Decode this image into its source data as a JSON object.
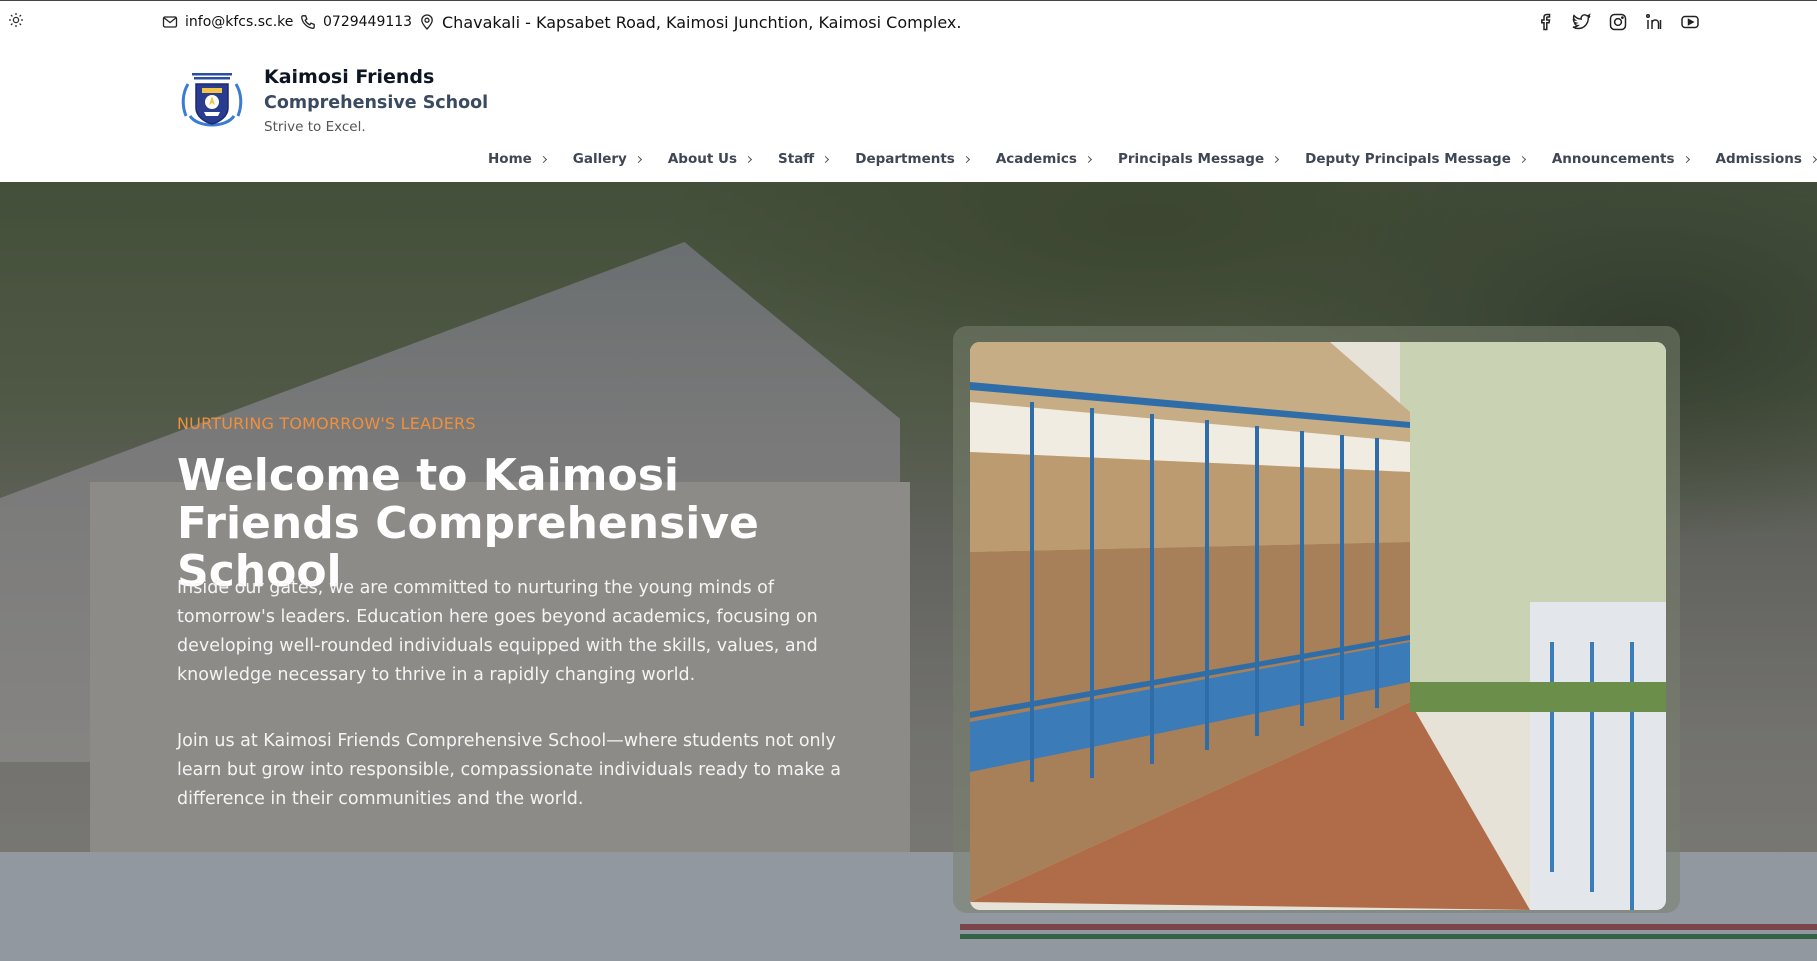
{
  "topbar": {
    "email": "info@kfcs.sc.ke",
    "phone": "0729449113",
    "address": "Chavakali - Kapsabet Road, Kaimosi Junchtion, Kaimosi Complex.",
    "socials": [
      "facebook-icon",
      "twitter-icon",
      "instagram-icon",
      "linkedin-icon",
      "youtube-icon"
    ]
  },
  "header": {
    "brand_name": "Kaimosi Friends",
    "brand_sub": "Comprehensive School",
    "tagline": "Strive to Excel."
  },
  "nav": {
    "items": [
      {
        "label": "Home"
      },
      {
        "label": "Gallery"
      },
      {
        "label": "About Us"
      },
      {
        "label": "Staff"
      },
      {
        "label": "Departments"
      },
      {
        "label": "Academics"
      },
      {
        "label": "Principals Message"
      },
      {
        "label": "Deputy Principals Message"
      },
      {
        "label": "Announcements"
      },
      {
        "label": "Admissions"
      }
    ]
  },
  "hero": {
    "eyebrow": "NURTURING TOMORROW'S LEADERS",
    "title": "Welcome to Kaimosi Friends Comprehensive School",
    "paragraph1": "Inside our gates, we are committed to nurturing the young minds of tomorrow's leaders. Education here goes beyond academics, focusing on developing well-rounded individuals equipped with the skills, values, and knowledge necessary to thrive in a rapidly changing world.",
    "paragraph2": "Join us at Kaimosi Friends Comprehensive School—where students not only learn but grow into responsible, compassionate individuals ready to make a difference in their communities and the world.",
    "accent_color": "#f0903c"
  }
}
